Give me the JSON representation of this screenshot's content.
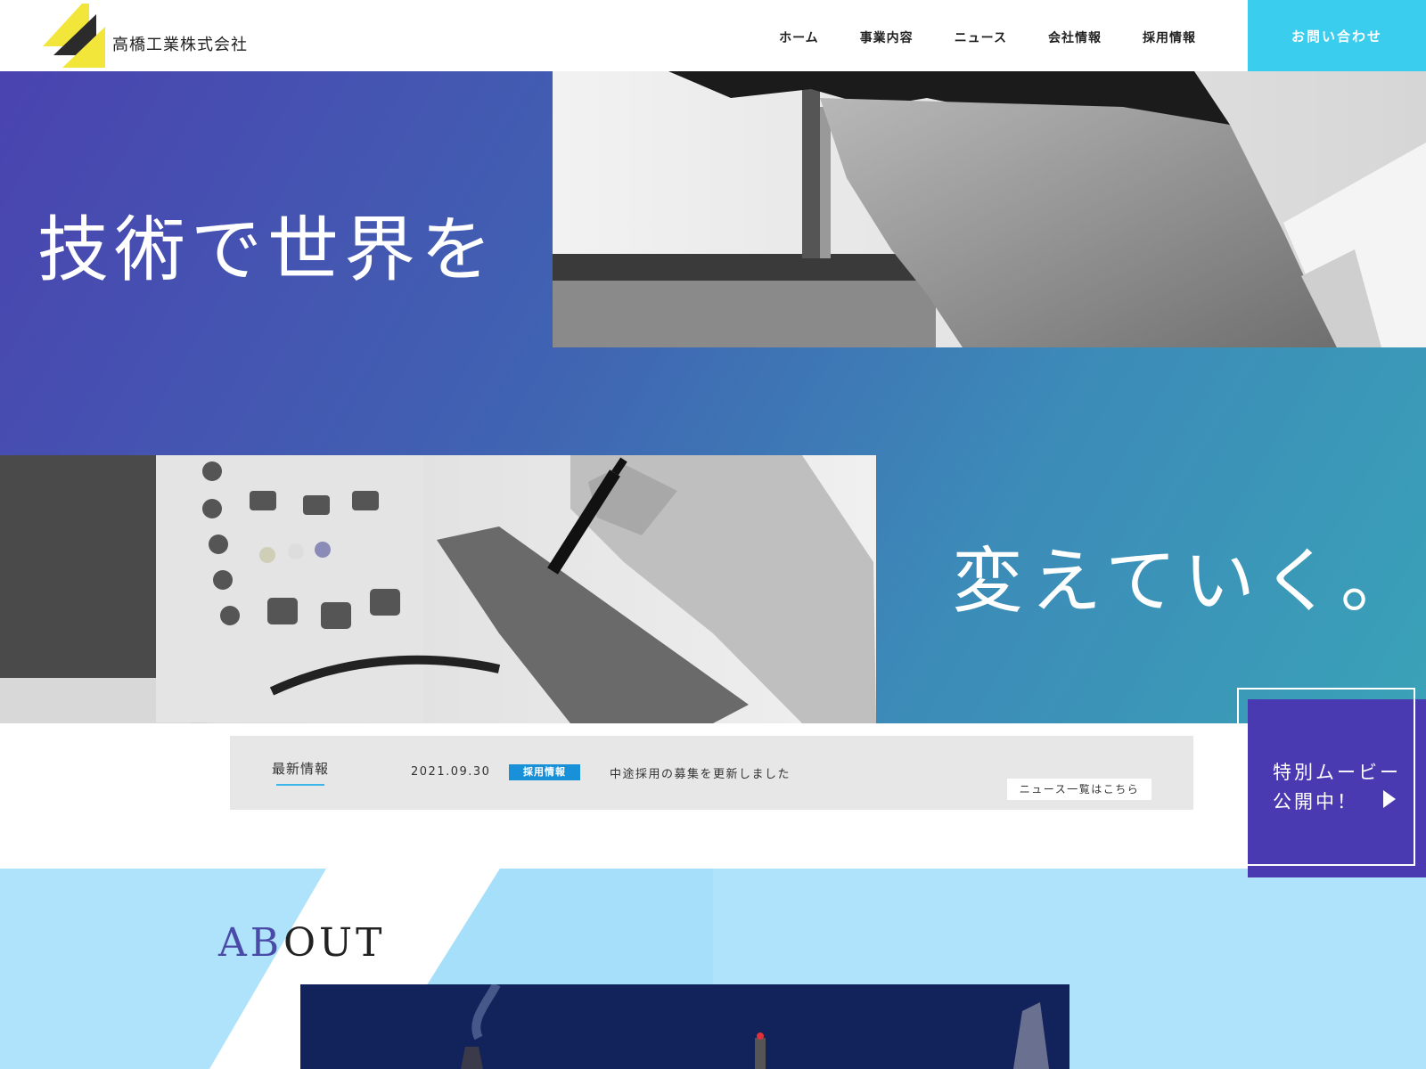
{
  "header": {
    "company_name": "高橋工業株式会社",
    "nav": [
      "ホーム",
      "事業内容",
      "ニュース",
      "会社情報",
      "採用情報"
    ],
    "contact_label": "お問い合わせ"
  },
  "hero": {
    "title_line1": "技術で世界を",
    "title_line2": "変えていく。"
  },
  "movie": {
    "line1": "特別ムービー",
    "line2": "公開中！"
  },
  "news": {
    "label": "最新情報",
    "date": "2021.09.30",
    "category": "採用情報",
    "text": "中途採用の募集を更新しました",
    "more_label": "ニュース一覧はこちら"
  },
  "about": {
    "title_part1": "AB",
    "title_part2": "OUT"
  },
  "colors": {
    "accent_cyan": "#3bcdee",
    "hero_start": "#4a43b0",
    "hero_end": "#3aa2b8",
    "movie_purple": "#4a3ab2",
    "logo_yellow": "#f2e63a",
    "about_bg": "#aee3fb"
  }
}
